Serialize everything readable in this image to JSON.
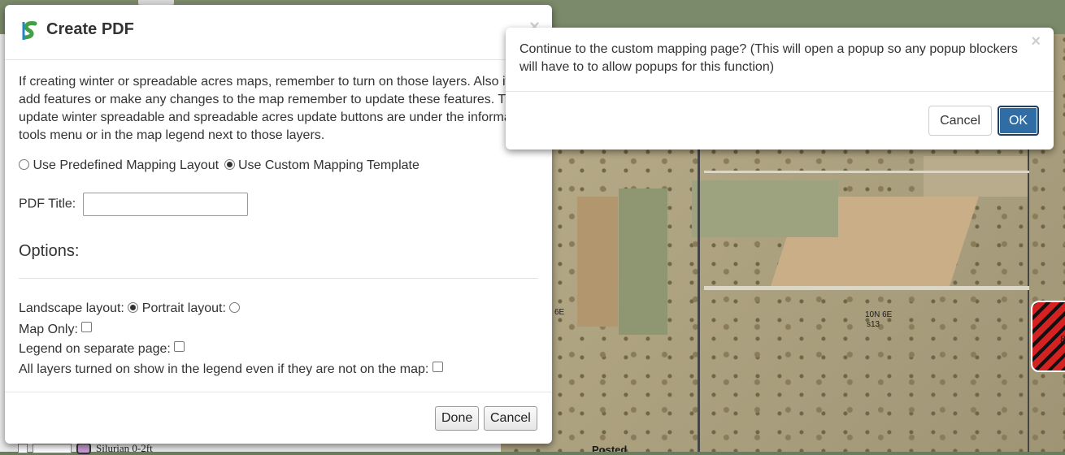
{
  "background": {
    "legend_row_label": "Silurian 0-2ft",
    "map_labels": [
      "6E",
      "10N 6E",
      "s13",
      "8",
      "Posted"
    ]
  },
  "create_pdf_modal": {
    "title": "Create PDF",
    "close_glyph": "×",
    "intro_lines": [
      "If creating winter or spreadable acres maps, remember to turn on those layers. Also if y",
      "add features or make any changes to the map remember to update these features. The",
      "update winter spreadable and spreadable acres update buttons are under the informat",
      "tools menu or in the map legend next to those layers."
    ],
    "layout_options": {
      "predefined_label": "Use Predefined Mapping Layout",
      "custom_label": "Use Custom Mapping Template",
      "selected": "custom"
    },
    "pdf_title": {
      "label": "PDF Title:",
      "value": "",
      "placeholder": ""
    },
    "options_heading": "Options:",
    "options": {
      "landscape_label": "Landscape layout:",
      "portrait_label": "Portrait layout:",
      "orientation_selected": "landscape",
      "map_only_label": "Map Only:",
      "map_only_checked": false,
      "legend_separate_label": "Legend on separate page:",
      "legend_separate_checked": false,
      "all_layers_label": "All layers turned on show in the legend even if they are not on the map:",
      "all_layers_checked": false
    },
    "footer": {
      "done_label": "Done",
      "cancel_label": "Cancel"
    }
  },
  "confirm_popup": {
    "message_lines": [
      "Continue to the custom mapping page? (This will open a popup so any popup blockers",
      "will have to to allow popups for this function)"
    ],
    "close_glyph": "×",
    "cancel_label": "Cancel",
    "ok_label": "OK"
  },
  "colors": {
    "ok_button": "#2f6da4",
    "hatch_red": "#d42222"
  }
}
